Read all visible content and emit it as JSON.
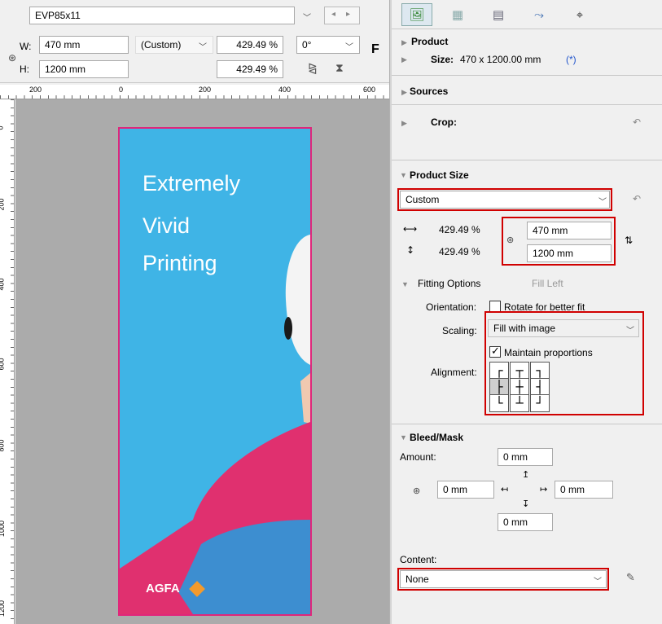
{
  "toolbar": {
    "product_name": "EVP85x11",
    "w_label": "W:",
    "h_label": "H:",
    "width_value": "470 mm",
    "height_value": "1200 mm",
    "size_mode": "(Custom)",
    "width_percent": "429.49 %",
    "height_percent": "429.49 %",
    "rotation": "0°",
    "flip_label": "F"
  },
  "ruler": {
    "h_ticks": [
      "200",
      "0",
      "200",
      "400",
      "600"
    ],
    "v_ticks": [
      "0",
      "200",
      "400",
      "600",
      "800",
      "1000",
      "1200"
    ]
  },
  "canvas": {
    "headline_1": "Extremely",
    "headline_2": "Vivid",
    "headline_3": "Printing",
    "logo_text": "AGFA",
    "colors": {
      "sky": "#3fb4e6",
      "border": "#e0267a",
      "sweater": "#e0306f",
      "sweater_blue": "#3d8ed0",
      "pasteboard": "#ababab"
    }
  },
  "panel": {
    "product": {
      "title": "Product",
      "size_label": "Size:",
      "size_value": "470 x 1200.00 mm",
      "size_marker": "(*)"
    },
    "sources": {
      "title": "Sources"
    },
    "crop": {
      "title": "Crop:"
    },
    "product_size": {
      "title": "Product Size",
      "preset": "Custom",
      "width_percent": "429.49 %",
      "height_percent": "429.49 %",
      "width_value": "470 mm",
      "height_value": "1200 mm"
    },
    "fitting": {
      "title": "Fitting Options",
      "status": "Fill Left",
      "orientation_label": "Orientation:",
      "rotate_label": "Rotate for better fit",
      "rotate_checked": false,
      "scaling_label": "Scaling:",
      "scaling_value": "Fill with image",
      "maintain_label": "Maintain proportions",
      "maintain_checked": true,
      "alignment_label": "Alignment:",
      "alignment_selected": "middle-left"
    },
    "bleed": {
      "title": "Bleed/Mask",
      "amount_label": "Amount:",
      "top": "0 mm",
      "left": "0 mm",
      "right": "0 mm",
      "bottom": "0 mm"
    },
    "content": {
      "label": "Content:",
      "value": "None"
    }
  }
}
